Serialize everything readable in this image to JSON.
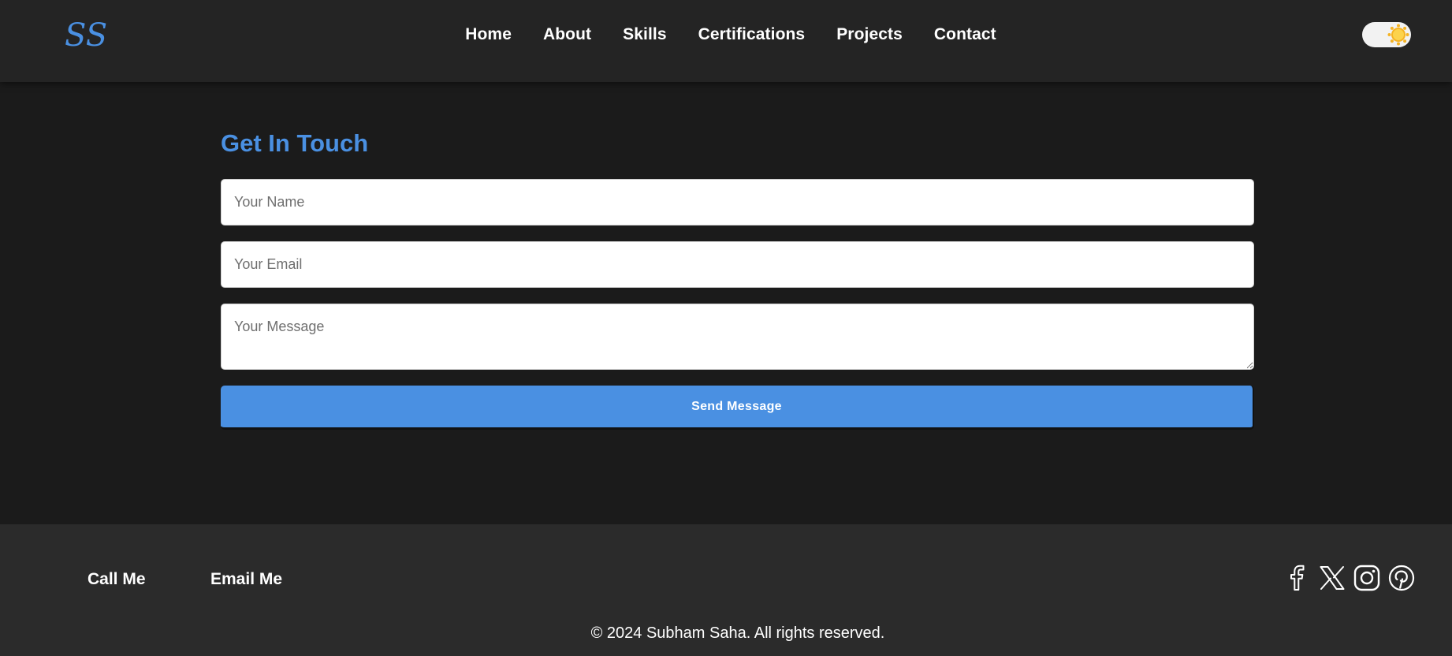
{
  "header": {
    "logo_text": "SS",
    "nav": [
      {
        "label": "Home"
      },
      {
        "label": "About"
      },
      {
        "label": "Skills"
      },
      {
        "label": "Certifications"
      },
      {
        "label": "Projects"
      },
      {
        "label": "Contact"
      }
    ],
    "theme_toggle": {
      "icon": "sun-icon",
      "state": "light-mode-toggle"
    }
  },
  "contact": {
    "title": "Get In Touch",
    "name_placeholder": "Your Name",
    "email_placeholder": "Your Email",
    "message_placeholder": "Your Message",
    "send_label": "Send Message"
  },
  "footer": {
    "call_label": "Call Me",
    "email_label": "Email Me",
    "socials": [
      "facebook-icon",
      "x-icon",
      "instagram-icon",
      "pinterest-icon"
    ],
    "copyright": "© 2024 Subham Saha. All rights reserved."
  },
  "colors": {
    "accent": "#4a90e2",
    "nav_bg": "#242424",
    "page_bg": "#1b1b1b",
    "footer_bg": "#2b2b2b",
    "sun": "#f5b324"
  }
}
